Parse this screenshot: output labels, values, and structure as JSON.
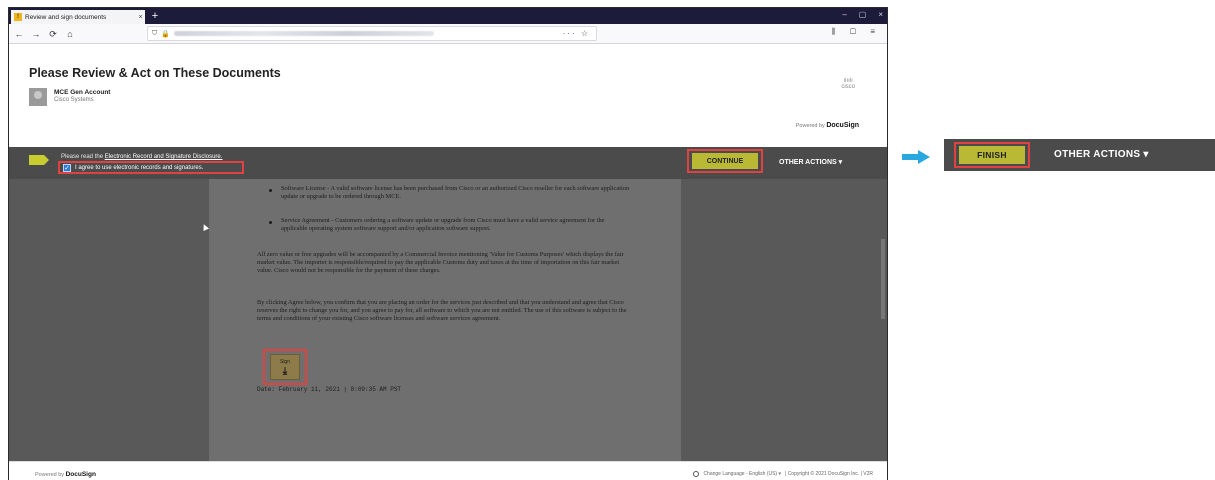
{
  "browser": {
    "tab_title": "Review and sign documents",
    "tab_close": "×",
    "new_tab": "+",
    "window_controls": [
      "–",
      "▢",
      "×"
    ],
    "url_lock": "🔒",
    "url_actions": "··· ☆",
    "toolbar_icons": "⫼ ▢ ≡"
  },
  "header": {
    "title": "Please Review & Act on These Documents",
    "sender_name": "MCE Gen Account",
    "sender_company": "Cisco Systems",
    "cisco_logo": "cisco",
    "powered_prefix": "Powered by",
    "powered_brand": "DocuSign"
  },
  "actionbar": {
    "disclosure_prefix": "Please read the",
    "disclosure_link": "Electronic Record and Signature Disclosure.",
    "agree_label": "I agree to use electronic records and signatures.",
    "continue_label": "CONTINUE",
    "other_actions_label": "OTHER ACTIONS ▾"
  },
  "document": {
    "bullet1": "Software License - A valid software license has been purchased from Cisco or an authorized Cisco reseller for each software application update or upgrade to be ordered through MCE.",
    "bullet2": "Service Agreement - Customers ordering a software update or upgrade from Cisco must have a valid service agreement for the applicable operating system software support and/or application software support.",
    "para1": "All zero value or free upgrades will be accompanied by a Commercial Invoice mentioning 'Value for Customs Purposes' which displays the fair market value. The importer is responsible/required to pay the applicable Customs duty and taxes at the time of importation on this fair market value. Cisco would not be responsible for the payment of these charges.",
    "para2": "By clicking Agree below, you confirm that you are placing an order for the services just described and that you understand and agree that Cisco reserves the right to change you for, and you agree to pay for, all software to which you are not entitled. The use of this software is subject to the terms and conditions of your existing Cisco software licenses and software services agreement.",
    "sign_label": "Sign",
    "sign_arrow": "⤓",
    "date_line": "Date: February 11, 2021 | 8:09:35 AM PST"
  },
  "footer": {
    "powered_prefix": "Powered by",
    "powered_brand": "DocuSign",
    "language": "Change Language - English (US) ▾",
    "copyright": "| Copyright © 2021 DocuSign Inc. | V2R"
  },
  "callout": {
    "finish_label": "FINISH",
    "other_actions_label": "OTHER ACTIONS ▾"
  },
  "colors": {
    "accent_button": "#b9b936",
    "highlight_border": "#e04141",
    "action_bar": "#4b4b4b",
    "arrow": "#29a8df"
  }
}
